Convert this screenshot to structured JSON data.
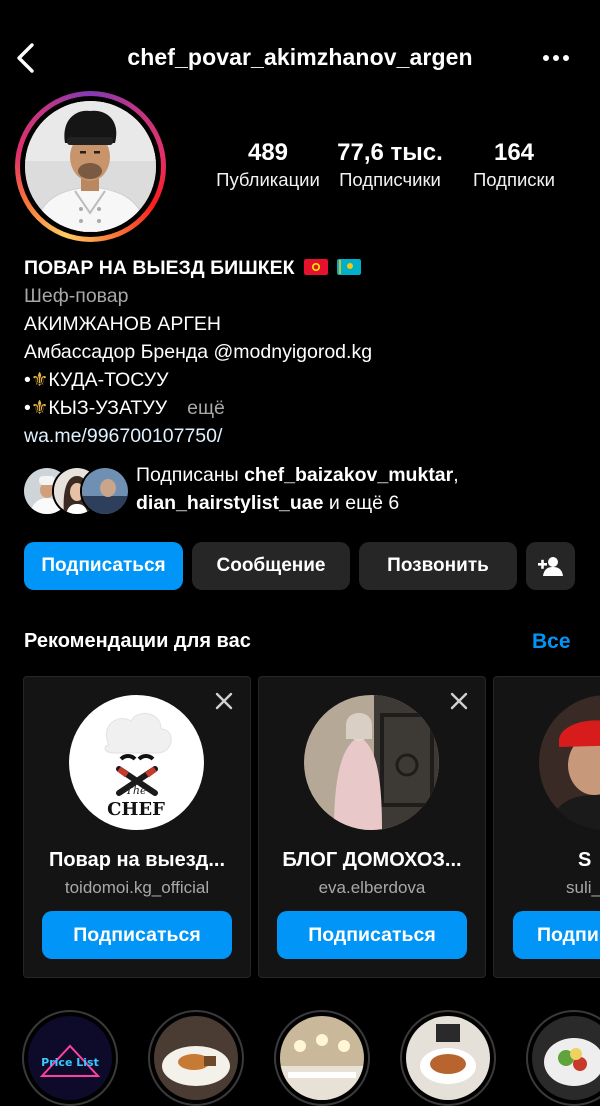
{
  "header": {
    "username": "chef_povar_akimzhanov_argen",
    "back_icon": "chevron-left-icon",
    "more_icon": "more-horizontal-icon"
  },
  "stats": {
    "posts": {
      "value": "489",
      "label": "Публикации"
    },
    "followers": {
      "value": "77,6 тыс.",
      "label": "Подписчики"
    },
    "following": {
      "value": "164",
      "label": "Подписки"
    }
  },
  "bio": {
    "name": "ПОВАР НА ВЫЕЗД БИШКЕК",
    "category": "Шеф-повар",
    "line1": "АКИМЖАНОВ АРГЕН",
    "line2_prefix": "Амбассадор Бренда ",
    "line2_mention": "@modnyigorod.kg",
    "bullet1": "КУДА-ТОСУУ",
    "bullet2": "КЫЗ-УЗАТУУ",
    "bullet_prefix": "•",
    "more": "ещё",
    "link": "wa.me/996700107750/"
  },
  "followed_by": {
    "prefix": "Подписаны ",
    "user1": "chef_baizakov_muktar",
    "separator": ",",
    "user2": "dian_hairstylist_uae",
    "suffix": " и ещё 6"
  },
  "actions": {
    "follow": "Подписаться",
    "message": "Сообщение",
    "call": "Позвонить",
    "add_user_icon": "person-add-icon"
  },
  "suggestions": {
    "title": "Рекомендации для вас",
    "see_all": "Все",
    "cards": [
      {
        "name": "Повар на выезд...",
        "handle": "toidomoi.kg_official",
        "button": "Подписаться",
        "logo_text": "The CHEF"
      },
      {
        "name": "БЛОГ ДОМОХОЗ...",
        "handle": "eva.elberdova",
        "button": "Подписаться"
      },
      {
        "name": "S",
        "handle": "suli_",
        "button": "Подпи"
      }
    ]
  },
  "highlights": {
    "first_label": "Price List"
  },
  "colors": {
    "accent": "#0095f6",
    "background": "#000000",
    "button_secondary": "#262626",
    "muted_text": "#a8a8a8"
  }
}
